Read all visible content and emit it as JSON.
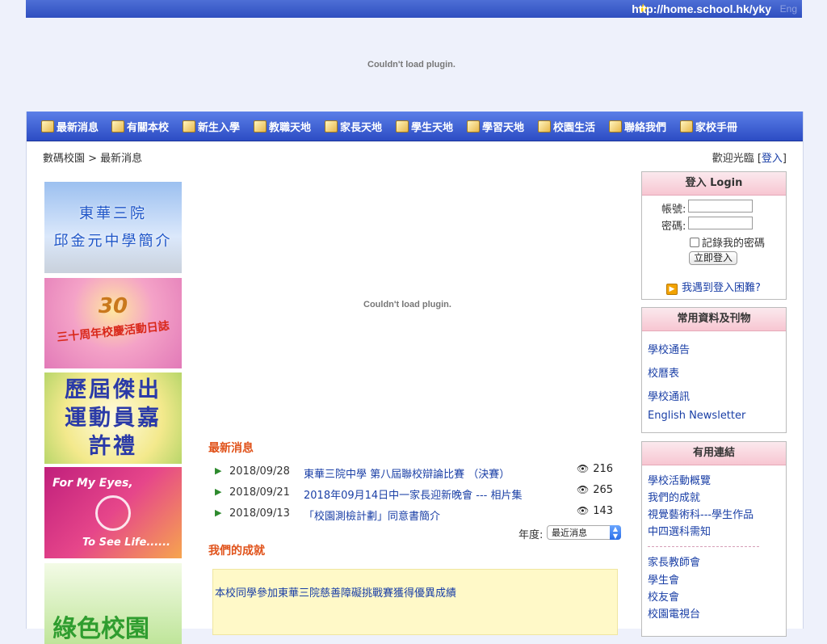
{
  "topbar": {
    "url": "http://home.school.hk/yky",
    "lang": "Eng"
  },
  "plugin_message": "Couldn't load plugin.",
  "nav": [
    "最新消息",
    "有關本校",
    "新生入學",
    "教職天地",
    "家長天地",
    "學生天地",
    "學習天地",
    "校園生活",
    "聯絡我們",
    "家校手冊"
  ],
  "breadcrumb": "數碼校園 > 最新消息",
  "welcome": {
    "text": "歡迎光臨 [",
    "login": "登入",
    "close": "]"
  },
  "banners": {
    "intro_line1": "東華三院",
    "intro_line2": "邱金元中學簡介",
    "anniv_big": "30",
    "anniv_text": "三十周年校慶活動日誌",
    "athletes_text": "歷屆傑出運動員嘉許禮",
    "eyes_line1": "For My Eyes,",
    "eyes_line2": "To See Life......",
    "green_text": "綠色校園"
  },
  "news_section": {
    "title": "最新消息",
    "items": [
      {
        "date": "2018/09/28",
        "title": "東華三院中學 第八屆聯校辯論比賽 （決賽）",
        "views": "216"
      },
      {
        "date": "2018/09/21",
        "title": "2018年09月14日中一家長迎新晚會 --- 相片集",
        "views": "265"
      },
      {
        "date": "2018/09/13",
        "title": "「校園測檢計劃」同意書簡介",
        "views": "143"
      }
    ],
    "year_label": "年度:",
    "year_selected": "最近消息"
  },
  "achievement_section": {
    "title": "我們的成就",
    "item": "本校同學參加東華三院慈善障礙挑戰賽獲得優異成績"
  },
  "login_box": {
    "title": "登入 Login",
    "username_label": "帳號:",
    "password_label": "密碼:",
    "remember_label": "記錄我的密碼",
    "submit_label": "立即登入",
    "help_label": "我遇到登入困難?"
  },
  "resources_box": {
    "title": "常用資料及刊物",
    "items": [
      "學校通告",
      "校曆表",
      "學校通訊",
      "English Newsletter"
    ]
  },
  "useful_links_box": {
    "title": "有用連結",
    "items": [
      "學校活動概覽",
      "我們的成就",
      "視覺藝術科---學生作品",
      "中四選科需知",
      "家長教師會",
      "學生會",
      "校友會",
      "校園電視台"
    ]
  }
}
